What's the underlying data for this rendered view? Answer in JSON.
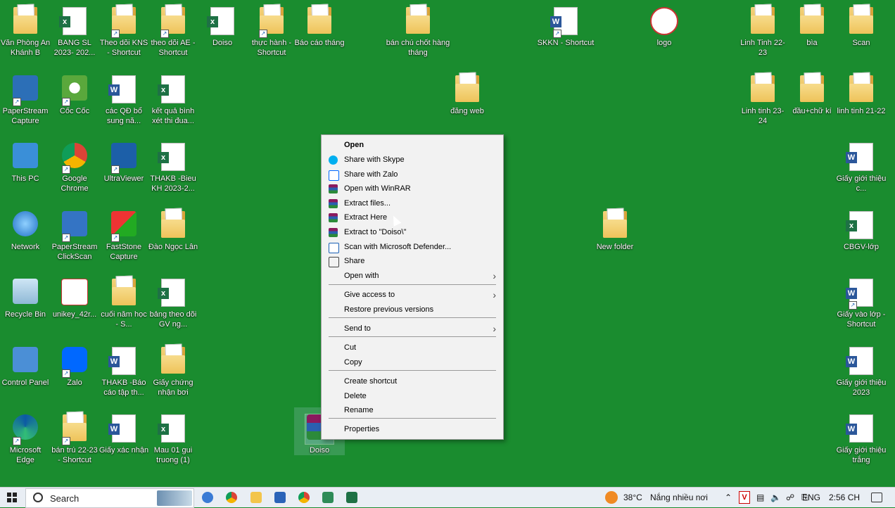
{
  "desktop": {
    "icons": [
      {
        "label": "Văn Phòng An Khánh B",
        "kind": "folder"
      },
      {
        "label": "BANG SL 2023- 202...",
        "kind": "xls"
      },
      {
        "label": "Theo dõi KNS - Shortcut",
        "kind": "folder"
      },
      {
        "label": "theo dõi AE - Shortcut",
        "kind": "folder"
      },
      {
        "label": "Doiso",
        "kind": "xls"
      },
      {
        "label": "thực hành - Shortcut",
        "kind": "folder"
      },
      {
        "label": "Báo cáo tháng",
        "kind": "folder"
      },
      {
        "label": "bán chú chốt hàng tháng",
        "kind": "folder"
      },
      {
        "label": "SKKN - Shortcut",
        "kind": "doc"
      },
      {
        "label": "logo",
        "kind": "image"
      },
      {
        "label": "Linh Tinh 22-23",
        "kind": "folder"
      },
      {
        "label": "bìa",
        "kind": "folder"
      },
      {
        "label": "Scan",
        "kind": "folder"
      },
      {
        "label": "PaperStream Capture",
        "kind": "app"
      },
      {
        "label": "Cốc Cốc",
        "kind": "app"
      },
      {
        "label": "các QĐ bổ sung nă...",
        "kind": "doc"
      },
      {
        "label": "kết quả bình xét thi đua...",
        "kind": "xls"
      },
      {
        "label": "đăng web",
        "kind": "folder"
      },
      {
        "label": "Linh tinh 23-24",
        "kind": "folder"
      },
      {
        "label": "đầu+chữ kí",
        "kind": "folder"
      },
      {
        "label": "linh tinh 21-22",
        "kind": "folder"
      },
      {
        "label": "This PC",
        "kind": "app"
      },
      {
        "label": "Google Chrome",
        "kind": "app"
      },
      {
        "label": "UltraViewer",
        "kind": "app"
      },
      {
        "label": "THAKB -Bieu KH 2023-2...",
        "kind": "xls"
      },
      {
        "label": "Giấy giới thiệu c...",
        "kind": "doc"
      },
      {
        "label": "Network",
        "kind": "app"
      },
      {
        "label": "PaperStream ClickScan",
        "kind": "app"
      },
      {
        "label": "FastStone Capture",
        "kind": "app"
      },
      {
        "label": "Đào Ngọc Lân",
        "kind": "folder"
      },
      {
        "label": "New folder",
        "kind": "folder"
      },
      {
        "label": "CBGV-lớp",
        "kind": "xls"
      },
      {
        "label": "Recycle Bin",
        "kind": "app"
      },
      {
        "label": "unikey_42r...",
        "kind": "app"
      },
      {
        "label": "cuối năm học - S...",
        "kind": "folder"
      },
      {
        "label": "bảng theo dõi GV ng...",
        "kind": "xls"
      },
      {
        "label": "Giấy vào lớp - Shortcut",
        "kind": "doc"
      },
      {
        "label": "Control Panel",
        "kind": "app"
      },
      {
        "label": "Zalo",
        "kind": "app"
      },
      {
        "label": "THAKB -Báo cáo tập th...",
        "kind": "doc"
      },
      {
        "label": "Giấy chứng nhận bơi",
        "kind": "folder"
      },
      {
        "label": "Giấy giới thiệu 2023",
        "kind": "doc"
      },
      {
        "label": "Microsoft Edge",
        "kind": "app"
      },
      {
        "label": "bán trú 22-23 - Shortcut",
        "kind": "folder"
      },
      {
        "label": "Giấy xác nhận",
        "kind": "doc"
      },
      {
        "label": "Mau 01 gui truong (1)",
        "kind": "xls"
      },
      {
        "label": "Doiso",
        "kind": "rar"
      },
      {
        "label": "Giấy giới thiệu trắng",
        "kind": "doc"
      }
    ]
  },
  "context_menu": {
    "items": [
      {
        "label": "Open",
        "bold": true
      },
      {
        "label": "Share with Skype",
        "icon": "skype-icon"
      },
      {
        "label": "Share with Zalo",
        "icon": "zalo-icon"
      },
      {
        "label": "Open with WinRAR",
        "icon": "winrar-icon"
      },
      {
        "label": "Extract files...",
        "icon": "winrar-icon"
      },
      {
        "label": "Extract Here",
        "icon": "winrar-icon"
      },
      {
        "label": "Extract to \"Doiso\\\"",
        "icon": "winrar-icon"
      },
      {
        "label": "Scan with Microsoft Defender...",
        "icon": "defender-icon"
      },
      {
        "label": "Share",
        "icon": "share-icon"
      },
      {
        "label": "Open with",
        "submenu": true
      },
      {
        "label": "Give access to",
        "submenu": true
      },
      {
        "label": "Restore previous versions"
      },
      {
        "label": "Send to",
        "submenu": true
      },
      {
        "label": "Cut"
      },
      {
        "label": "Copy"
      },
      {
        "label": "Create shortcut"
      },
      {
        "label": "Delete"
      },
      {
        "label": "Rename"
      },
      {
        "label": "Properties"
      }
    ]
  },
  "taskbar": {
    "search_placeholder": "Search",
    "weather_temp": "38°C",
    "weather_text": "Nắng nhiều nơi",
    "language": "ENG",
    "time": "2:56 CH"
  },
  "colors": {
    "desktop_bg": "#1a8c2f",
    "menu_bg": "#f2f2f2",
    "highlight": "#fff000"
  }
}
